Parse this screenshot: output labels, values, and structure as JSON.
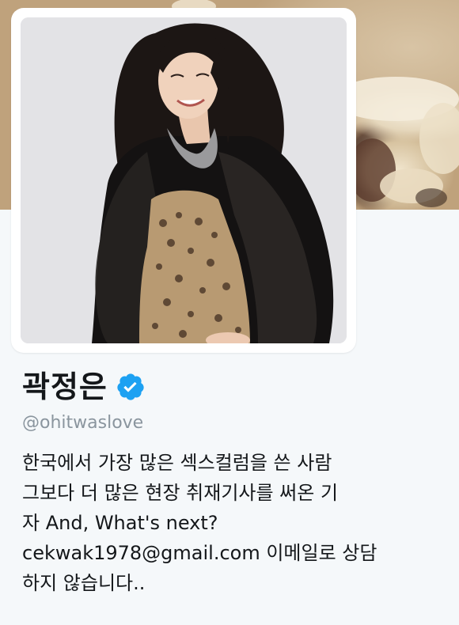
{
  "profile": {
    "display_name": "곽정은",
    "screen_name": "@ohitwaslove",
    "verified": true,
    "verified_icon": "verified-badge-icon",
    "accent_color": "#1da1f2",
    "bio_lines": [
      "한국에서 가장 많은 섹스컬럼을 쓴 사람",
      "그보다 더 많은 현장 취재기사를 써온 기",
      "자 And, What's next?",
      "cekwak1978@gmail.com 이메일로 상담",
      "하지 않습니다.."
    ]
  }
}
